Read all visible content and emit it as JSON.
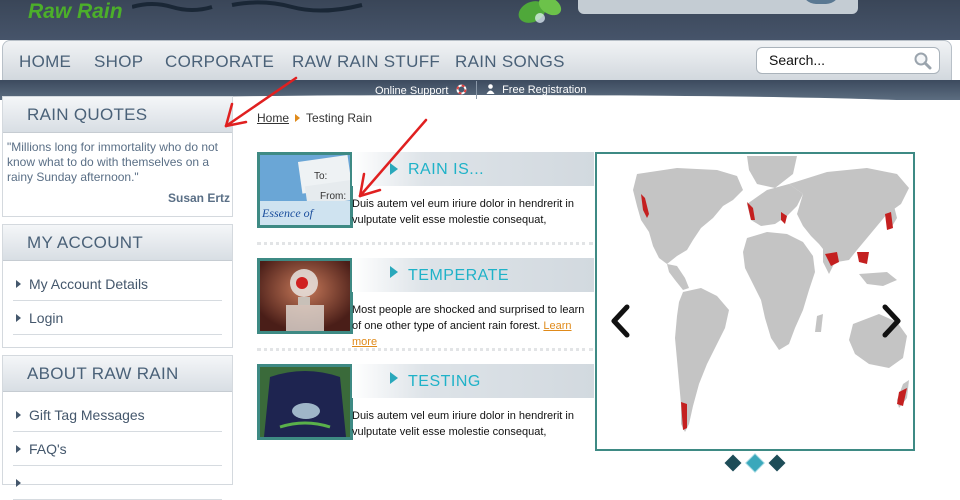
{
  "header": {
    "logo_text": "Raw Rain"
  },
  "nav": {
    "items": [
      "HOME",
      "SHOP",
      "CORPORATE",
      "RAW RAIN STUFF",
      "RAIN SONGS"
    ],
    "search_placeholder": "Search..."
  },
  "subbar": {
    "online_support": "Online Support",
    "free_registration": "Free Registration"
  },
  "sidebar": {
    "quotes": {
      "title": "RAIN QUOTES",
      "text": "\"Millions long for immortality who do not know what to do with themselves on a rainy Sunday afternoon.\"",
      "author": "Susan Ertz"
    },
    "account": {
      "title": "MY ACCOUNT",
      "items": [
        "My Account Details",
        "Login"
      ]
    },
    "about": {
      "title": "ABOUT RAW RAIN",
      "items": [
        "Gift Tag Messages",
        "FAQ's"
      ]
    }
  },
  "breadcrumb": {
    "home": "Home",
    "current": "Testing Rain"
  },
  "items": [
    {
      "title": "RAIN IS...",
      "text": "Duis autem vel eum iriure dolor in hendrerit in vulputate velit esse molestie consequat,",
      "link": ""
    },
    {
      "title": "TEMPERATE",
      "text": "Most people are shocked and surprised to learn of one other type of ancient rain forest.",
      "link": "Learn more"
    },
    {
      "title": "TESTING",
      "text": "Duis autem vel eum iriure dolor in hendrerit in vulputate velit esse molestie consequat,",
      "link": ""
    }
  ],
  "thumb_text": {
    "to": "To:",
    "from": "From:",
    "brand": "Essence of"
  },
  "slider": {
    "pages": 3,
    "active_page": 2
  },
  "colors": {
    "accent": "#1fb2c8",
    "frame": "#3e8a84",
    "nav_text": "#4a6178",
    "link_orange": "#e08a1a",
    "logo_green": "#4caf2a",
    "annotation_red": "#e02020"
  },
  "icons": {
    "search": "magnifier-icon",
    "support": "lifebuoy-icon",
    "registration": "user-icon",
    "breadcrumb": "triangle-right-icon",
    "prev": "chevron-left-icon",
    "next": "chevron-right-icon"
  }
}
